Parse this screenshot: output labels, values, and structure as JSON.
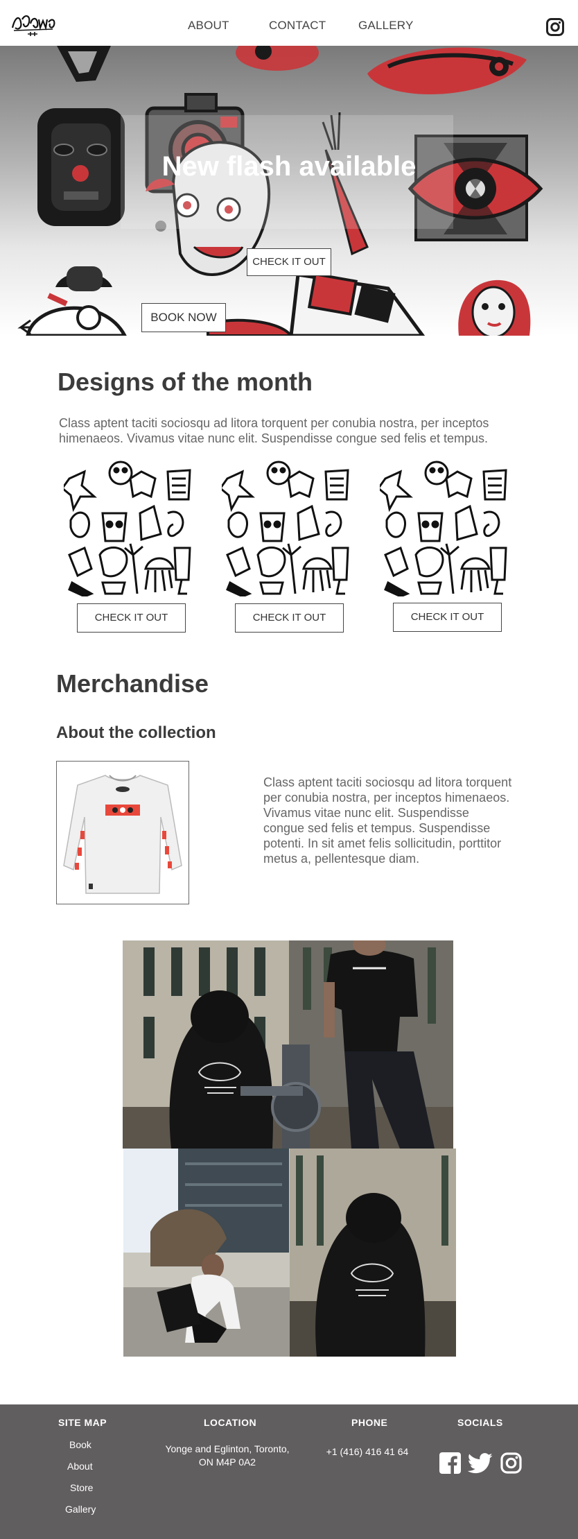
{
  "nav": {
    "about": "ABOUT",
    "contact": "CONTACT",
    "gallery": "GALLERY"
  },
  "icons": {
    "logo": "brand-logo",
    "instagram": "instagram-icon",
    "facebook": "facebook-icon",
    "twitter": "twitter-icon"
  },
  "colors": {
    "accent": "#e8483b",
    "footer_bg": "#615e5f",
    "heading": "#3b3b3b",
    "body_text": "#666666"
  },
  "hero": {
    "title": "New flash available",
    "check_button": "CHECK IT OUT",
    "book_button": "BOOK NOW"
  },
  "designs": {
    "title": "Designs of the month",
    "description": "Class aptent taciti sociosqu ad litora torquent per conubia nostra, per inceptos himenaeos. Vivamus vitae nunc elit. Suspendisse congue sed felis et tempus.",
    "cards": [
      {
        "button": "CHECK IT OUT"
      },
      {
        "button": "CHECK IT OUT"
      },
      {
        "button": "CHECK IT OUT"
      }
    ]
  },
  "merch": {
    "title": "Merchandise",
    "subtitle": "About the collection",
    "description": "Class aptent taciti sociosqu ad litora torquent per conubia nostra, per inceptos himenaeos. Vivamus vitae nunc elit. Suspendisse congue sed felis et tempus. Suspendisse potenti. In sit amet felis sollicitudin, porttitor metus a, pellentesque diam."
  },
  "footer": {
    "sitemap": {
      "heading": "SITE MAP",
      "links": [
        "Book",
        "About",
        "Store",
        "Gallery"
      ]
    },
    "location": {
      "heading": "LOCATION",
      "line1": "Yonge and Eglinton, Toronto,",
      "line2": "ON M4P 0A2"
    },
    "phone": {
      "heading": "PHONE",
      "value": "+1 (416) 416 41 64"
    },
    "socials": {
      "heading": "SOCIALS"
    }
  }
}
